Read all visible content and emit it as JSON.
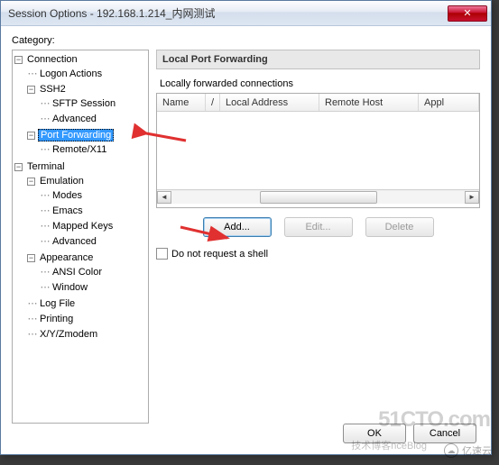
{
  "window": {
    "title": "Session Options - 192.168.1.214_内网测试",
    "close_glyph": "✕"
  },
  "category_label": "Category:",
  "tree": {
    "connection": "Connection",
    "logon_actions": "Logon Actions",
    "ssh2": "SSH2",
    "sftp_session": "SFTP Session",
    "advanced": "Advanced",
    "port_forwarding": "Port Forwarding",
    "remote_x11": "Remote/X11",
    "terminal": "Terminal",
    "emulation": "Emulation",
    "modes": "Modes",
    "emacs": "Emacs",
    "mapped_keys": "Mapped Keys",
    "advanced2": "Advanced",
    "appearance": "Appearance",
    "ansi_color": "ANSI Color",
    "window_node": "Window",
    "log_file": "Log File",
    "printing": "Printing",
    "xyzmodem": "X/Y/Zmodem"
  },
  "panel": {
    "title": "Local Port Forwarding",
    "list_label": "Locally forwarded connections",
    "columns": {
      "name": "Name",
      "sep": "/",
      "local_addr": "Local Address",
      "remote_host": "Remote Host",
      "appl": "Appl"
    },
    "buttons": {
      "add": "Add...",
      "edit": "Edit...",
      "delete": "Delete"
    },
    "checkbox_label": "Do not request a shell"
  },
  "dialog_buttons": {
    "ok": "OK",
    "cancel": "Cancel"
  },
  "watermarks": {
    "logo": "51CTO.com",
    "blog": "技术博客nceBlog",
    "brand": "亿速云"
  }
}
